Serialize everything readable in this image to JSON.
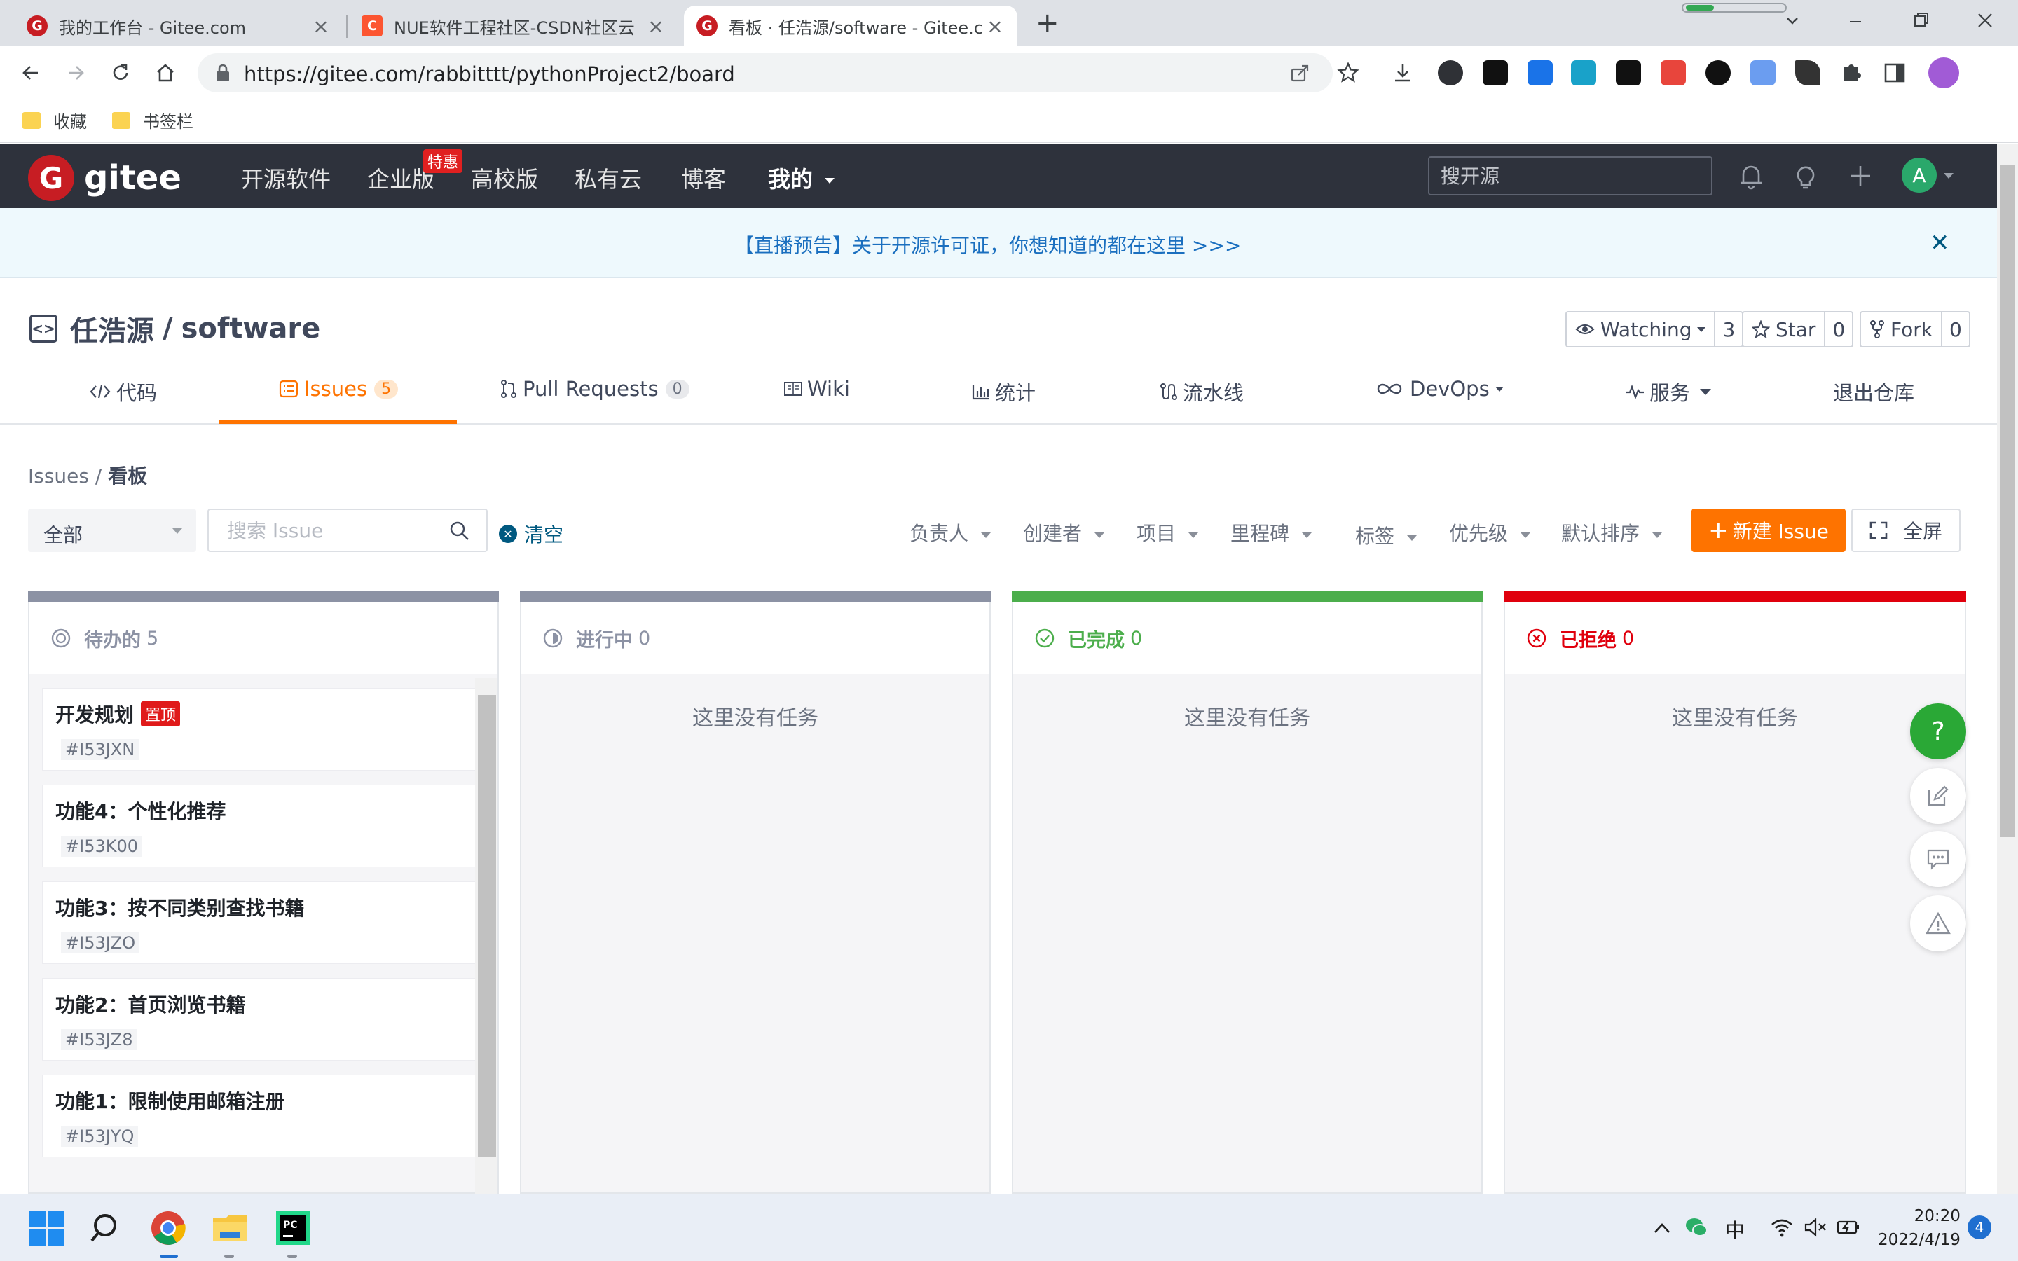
{
  "browser": {
    "tabs": [
      {
        "title": "我的工作台 - Gitee.com",
        "active": false
      },
      {
        "title": "NUE软件工程社区-CSDN社区云",
        "active": false
      },
      {
        "title": "看板 · 任浩源/software - Gitee.c",
        "active": true
      }
    ],
    "new_tab": "+",
    "url": "https://gitee.com/rabbitttt/pythonProject2/board",
    "bookmarks": [
      "收藏",
      "书签栏"
    ]
  },
  "header": {
    "logo_mark": "G",
    "logo_text": "gitee",
    "nav": [
      "开源软件",
      "企业版",
      "高校版",
      "私有云",
      "博客",
      "我的"
    ],
    "hot_badge": "特惠",
    "search_placeholder": "搜开源",
    "avatar": "A"
  },
  "announcement": {
    "text": "【直播预告】关于开源许可证，你想知道的都在这里 >>>",
    "close": "✕"
  },
  "repo": {
    "owner": "任浩源",
    "separator": "/",
    "name": "software",
    "watch_label": "Watching",
    "watch_count": "3",
    "star_label": "Star",
    "star_count": "0",
    "fork_label": "Fork",
    "fork_count": "0"
  },
  "repo_tabs": [
    {
      "label": "代码"
    },
    {
      "label": "Issues",
      "badge": "5"
    },
    {
      "label": "Pull Requests",
      "badge": "0"
    },
    {
      "label": "Wiki"
    },
    {
      "label": "统计"
    },
    {
      "label": "流水线"
    },
    {
      "label": "DevOps"
    },
    {
      "label": "服务"
    },
    {
      "label": "退出仓库"
    }
  ],
  "breadcrumb": {
    "root": "Issues",
    "sep": " / ",
    "current": "看板"
  },
  "filters": {
    "scope": "全部",
    "search_placeholder": "搜索 Issue",
    "clear": "清空",
    "items": [
      "负责人",
      "创建者",
      "项目",
      "里程碑",
      "标签",
      "优先级",
      "默认排序"
    ],
    "new_issue": "新建 Issue",
    "fullscreen": "全屏"
  },
  "board": {
    "columns": [
      {
        "name": "待办的",
        "count": "5",
        "color": "#8c92a4"
      },
      {
        "name": "进行中",
        "count": "0",
        "color": "#8c92a4",
        "empty": "这里没有任务"
      },
      {
        "name": "已完成",
        "count": "0",
        "color": "#4cae4c",
        "empty": "这里没有任务"
      },
      {
        "name": "已拒绝",
        "count": "0",
        "color": "#e0000d",
        "empty": "这里没有任务"
      }
    ],
    "cards": [
      {
        "title": "开发规划",
        "id": "#I53JXN",
        "pinned": "置顶"
      },
      {
        "title": "功能4：个性化推荐",
        "id": "#I53K00"
      },
      {
        "title": "功能3：按不同类别查找书籍",
        "id": "#I53JZO"
      },
      {
        "title": "功能2：首页浏览书籍",
        "id": "#I53JZ8"
      },
      {
        "title": "功能1：限制使用邮箱注册",
        "id": "#I53JYQ"
      }
    ]
  },
  "float_help": "?",
  "taskbar": {
    "time": "20:20",
    "date": "2022/4/19",
    "ime": "中",
    "notifications": "4"
  }
}
